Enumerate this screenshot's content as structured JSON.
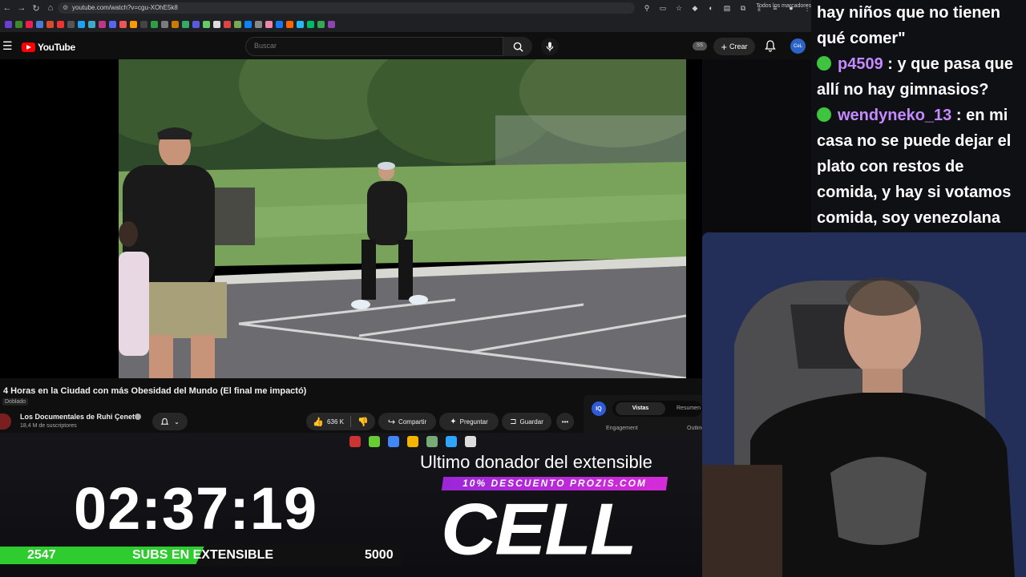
{
  "browser": {
    "url": "youtube.com/watch?v=cgu-XOhE5k8",
    "bookmarks_all_label": "Todos los marcadores",
    "bookmark_colors": [
      "#6b3fd6",
      "#3a8a2b",
      "#ee1d52",
      "#4a7bd8",
      "#d94b2b",
      "#e33",
      "#555",
      "#1da1f2",
      "#3ea8c6",
      "#c13584",
      "#5865f2",
      "#e55",
      "#f90",
      "#444",
      "#2ea043",
      "#7b7b7b",
      "#cc7a00",
      "#3a6",
      "#5a5ae0",
      "#6c6",
      "#ddd",
      "#d44",
      "#7a5",
      "#0a84ff",
      "#888",
      "#e8a",
      "#1877f2",
      "#f60",
      "#29b6f6",
      "#0b6",
      "#34a853",
      "#8e44ad"
    ]
  },
  "header": {
    "logo_text": "YouTube",
    "search_placeholder": "Buscar",
    "ss_badge": "SS",
    "create_label": "Crear",
    "avatar_text": "CeL"
  },
  "video": {
    "title": "4 Horas en la Ciudad con más Obesidad del Mundo (El final me impactó)",
    "dub_label": "Doblado",
    "channel_name": "Los Documentales de Ruhi Çenet",
    "subscribers": "18,4 M de suscriptores",
    "likes": "636 K",
    "share_label": "Compartir",
    "ask_label": "Preguntar",
    "save_label": "Guardar"
  },
  "iq_panel": {
    "logo": "IQ",
    "tab_active": "Vistas",
    "tab_other": "Resumen",
    "engagement_label": "Engagement",
    "outline_label": "Outline"
  },
  "taskbar": {
    "icon_colors": [
      "#c33",
      "#6c3",
      "#4285f4",
      "#f5b400",
      "#7a7",
      "#2fa4ff",
      "#ddd"
    ]
  },
  "overlay": {
    "timer": "02:37:19",
    "subs_current": "2547",
    "subs_label": "SUBS EN EXTENSIBLE",
    "subs_goal": "5000",
    "subs_progress": 0.5094,
    "donor_label": "Ultimo donador del extensible",
    "promo": "10% DESCUENTO PROZIS.COM",
    "donor_name": "CELL"
  },
  "chat": {
    "messages": [
      {
        "user": "",
        "text": "hay niños que no tienen"
      },
      {
        "user": "",
        "text": "qué comer\""
      },
      {
        "user": "p4509",
        "text": ": y que pasa que"
      },
      {
        "user": "",
        "text": "allí no hay gimnasios?"
      },
      {
        "user": "wendyneko_13",
        "text": ": en mi"
      },
      {
        "user": "",
        "text": "casa no se puede dejar el"
      },
      {
        "user": "",
        "text": "plato con restos de"
      },
      {
        "user": "",
        "text": "comida, y hay si votamos"
      },
      {
        "user": "",
        "text": "comida, soy venezolana"
      }
    ]
  }
}
